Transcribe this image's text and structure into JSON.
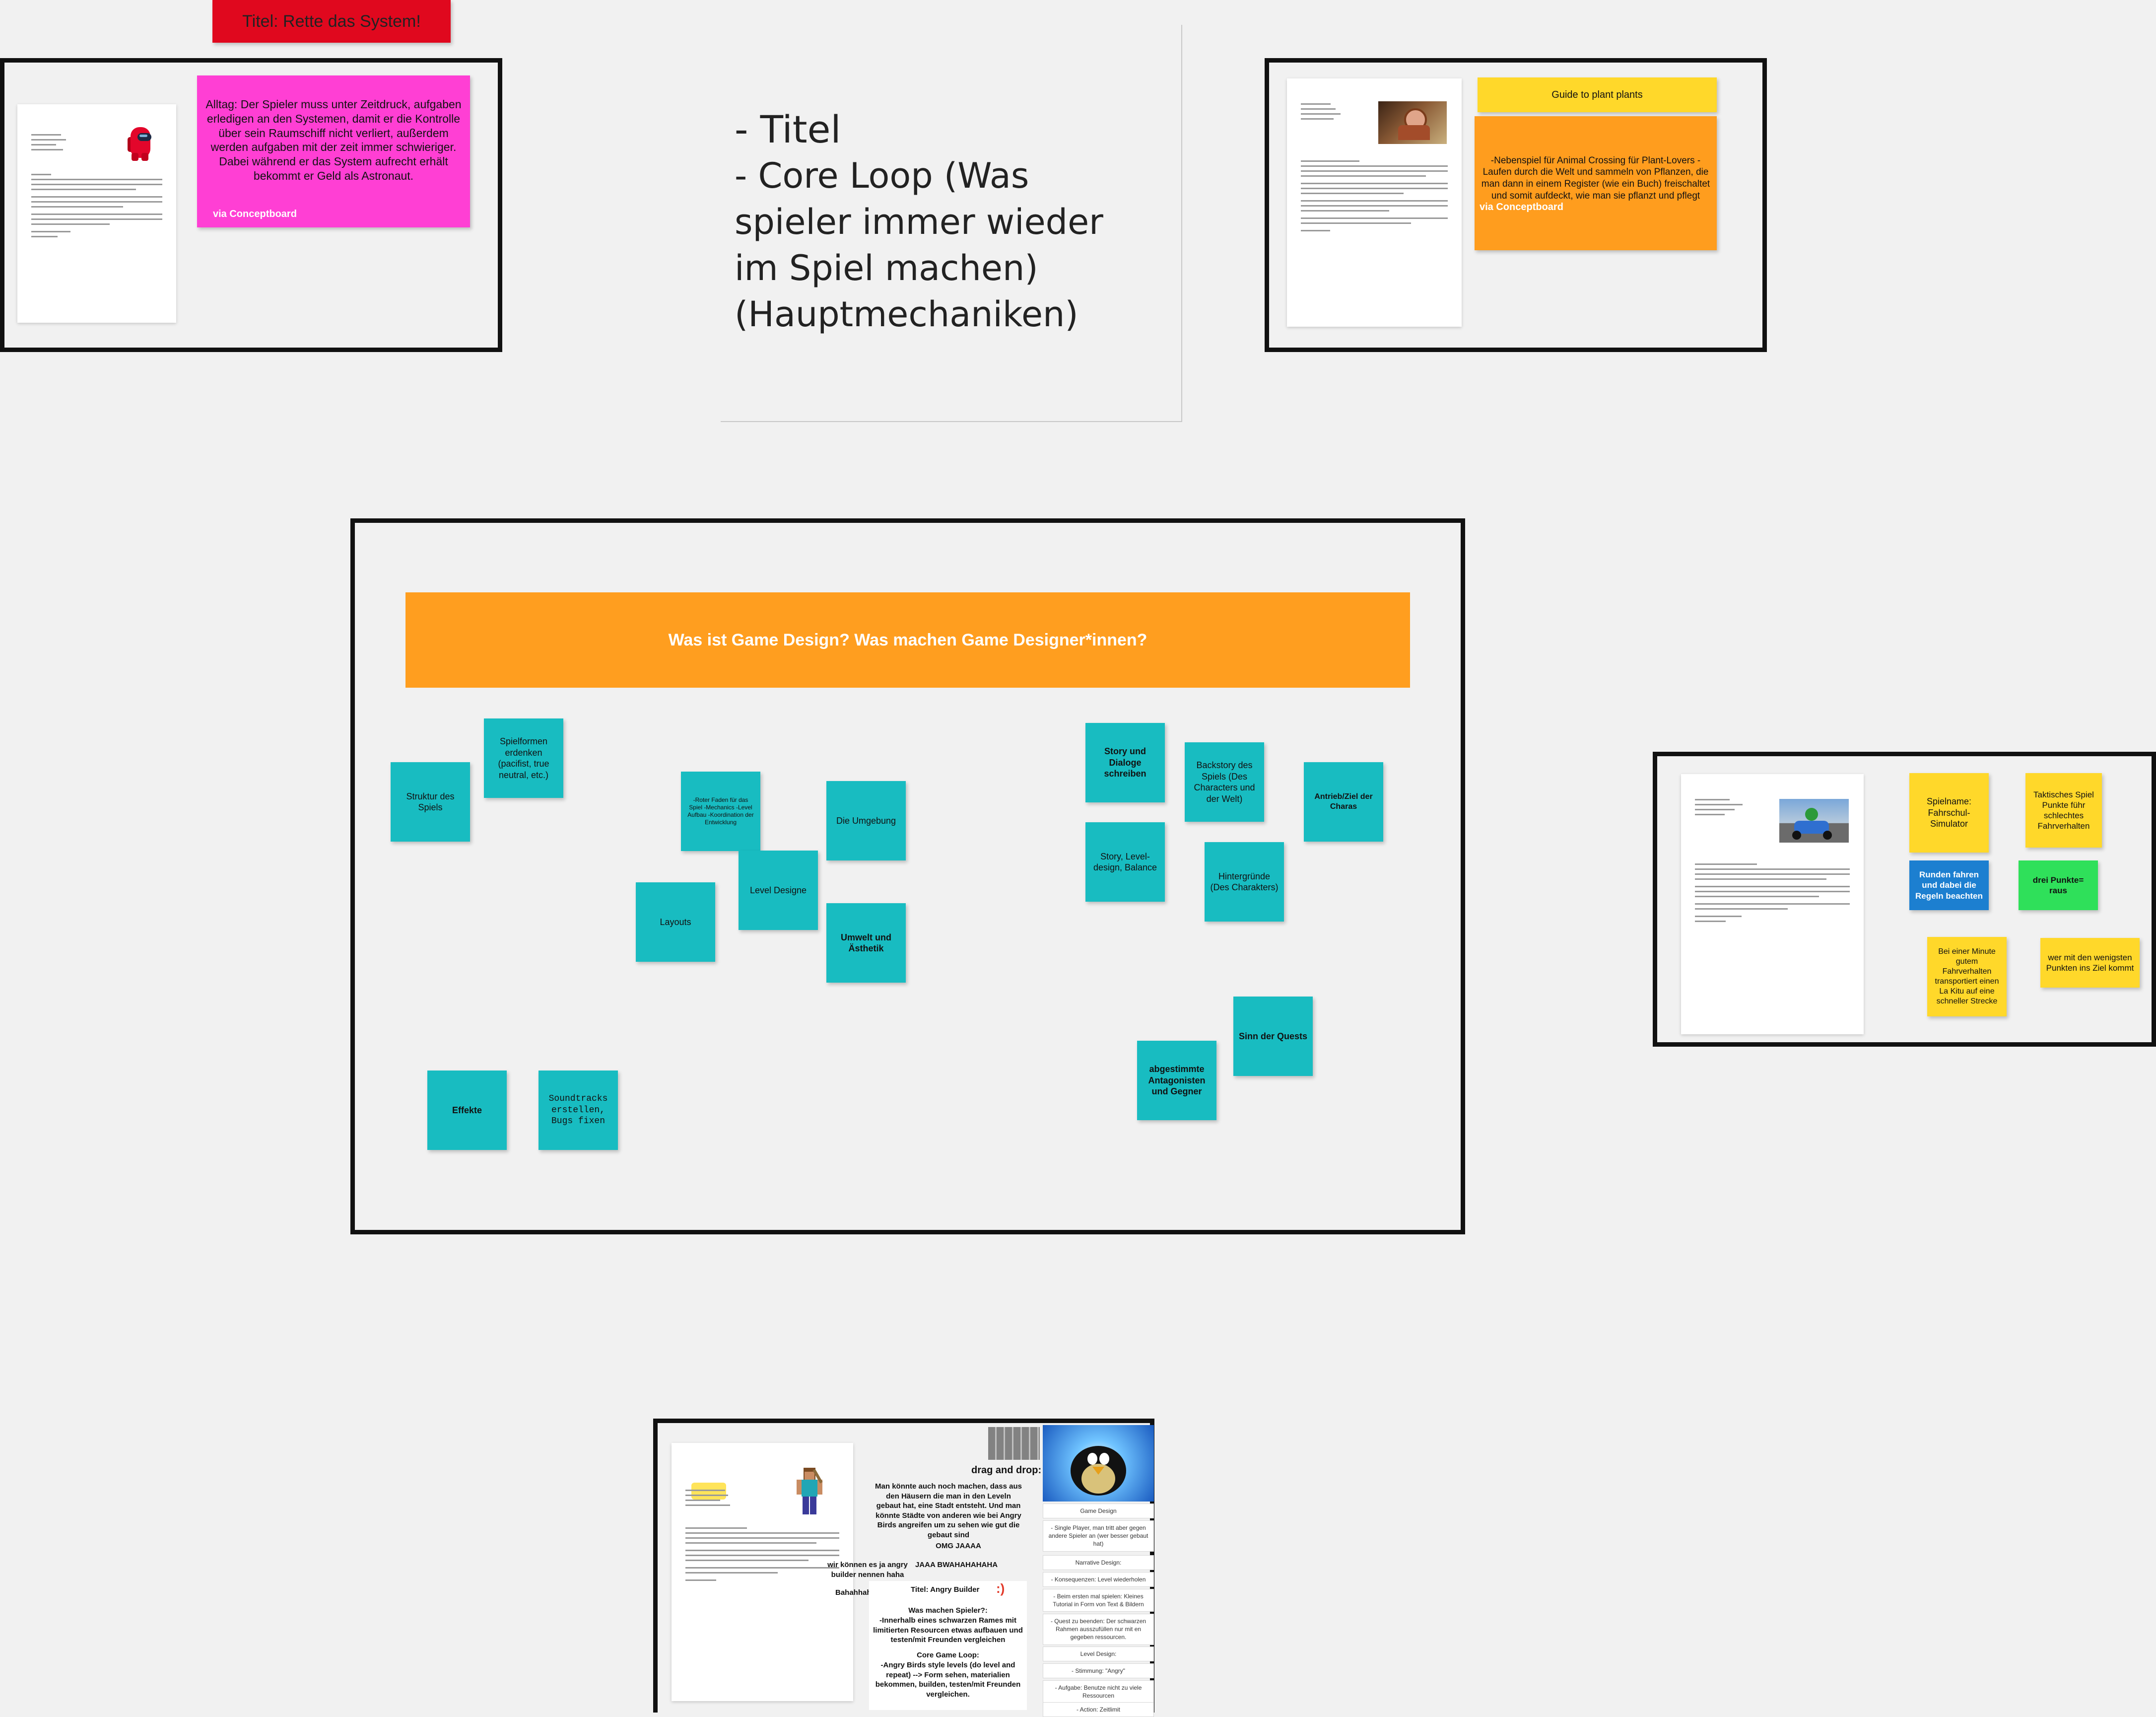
{
  "title_sticky": "Titel: Rette das System!",
  "frame1": {
    "note": "Alltag: Der Spieler muss unter Zeitdruck, aufgaben erledigen an den Systemen, damit er die Kontrolle über sein Raumschiff nicht verliert, außerdem werden aufgaben mit der zeit immer schwieriger. Dabei während er das System aufrecht erhält bekommt er Geld als Astronaut.",
    "via": "via Conceptboard",
    "colors": {
      "note": "#ff3fd4"
    },
    "icon": "astronaut-icon"
  },
  "center_text": [
    "- Titel",
    "- Core Loop (Was spieler immer wieder im Spiel machen) (Hauptmechaniken)"
  ],
  "frame2": {
    "yellow": "Guide to plant plants",
    "orange": "-Nebenspiel für Animal Crossing für Plant-Lovers -Laufen durch die Welt und sammeln von Pflanzen, die man dann in einem Register (wie ein Buch) freischaltet und somit aufdeckt, wie man sie pflanzt und pflegt",
    "via": "via Conceptboard",
    "colors": {
      "yellow": "#ffd82a",
      "orange": "#ff9d1e"
    },
    "icon": "character-photo-icon"
  },
  "gd_frame": {
    "header": "Was ist Game Design? Was machen Game Designer*innen?",
    "colors": {
      "header": "#ff9e1f",
      "sticky": "#18bcc1"
    },
    "stickies": [
      "Struktur des Spiels",
      "Spielformen erdenken (pacifist, true neutral, etc.)",
      "-Roter Faden für das Spiel -Mechanics -Level Aufbau -Koordination der Entwicklung",
      "Die Umgebung",
      "Level Designe",
      "Layouts",
      "Umwelt und Ästhetik",
      "Effekte",
      "Soundtracks erstellen, Bugs fixen",
      "Story und Dialoge schreiben",
      "Backstory des Spiels (Des Characters und der Welt)",
      "Antrieb/Ziel der Charas",
      "Story, Level-design, Balance",
      "Hintergründe (Des Charakters)",
      "Sinn der Quests",
      "abgestimmte Antagonisten und Gegner"
    ]
  },
  "frame3": {
    "stickies": [
      "Spielname: Fahrschul-Simulator",
      "Taktisches Spiel Punkte führ schlechtes Fahrverhalten",
      "Runden fahren und dabei die Regeln beachten",
      "drei Punkte= raus",
      "Bei einer Minute gutem Fahrverhalten transportiert einen La Kitu auf eine schneller Strecke",
      "wer mit den wenigsten Punkten ins Ziel kommt"
    ],
    "colors": {
      "yellow": "#ffd82a",
      "blue": "#1c7fd0",
      "green": "#2fe05a"
    },
    "icon": "kart-racer-icon"
  },
  "frame4": {
    "drag_drop": "drag and drop:",
    "idea": "Man könnte auch noch machen, dass aus den Häusern die man in den Leveln gebaut hat, eine Stadt entsteht. Und man könnte Städte von anderen wie bei Angry Birds angreifen um zu sehen wie gut die gebaut sind",
    "omg": "OMG JAAAA",
    "jaaa": "JAAA BWAHAHAHAHA",
    "angry_builder_q": "wir können es ja angry builder nennen haha",
    "bahahhah": "Bahahhah ja",
    "title": "Titel: Angry Builder",
    "players_head": "Was machen Spieler?:",
    "players": "-Innerhalb eines schwarzen Rames mit limitierten Resourcen etwas aufbauen und testen/mit Freunden vergleichen",
    "core_head": "Core Game Loop:",
    "core": "-Angry Birds style levels (do level and repeat) --> Form sehen, materialien bekommen, builden, testen/mit Freunden vergleichen.",
    "cards": [
      "Game Design",
      "- Single Player, man tritt aber gegen andere Spieler an (wer besser gebaut hat)",
      "Narrative Design:",
      "- Konsequenzen: Level wiederholen",
      "- Beim ersten mal spielen: Kleines Tutorial in Form von Text & Bildern",
      "- Quest zu beenden: Der schwarzen Rahmen ausszufüllen nur mit en gegeben ressourcen.",
      "Level Design:",
      "- Stimmung: \"Angry\"",
      "- Aufgabe: Benutze nicht zu viele Ressourcen",
      "- Action: Zeitlimit"
    ],
    "icons": [
      "minecraft-character-icon",
      "angry-bird-icon",
      "red-arrow-icon"
    ]
  }
}
